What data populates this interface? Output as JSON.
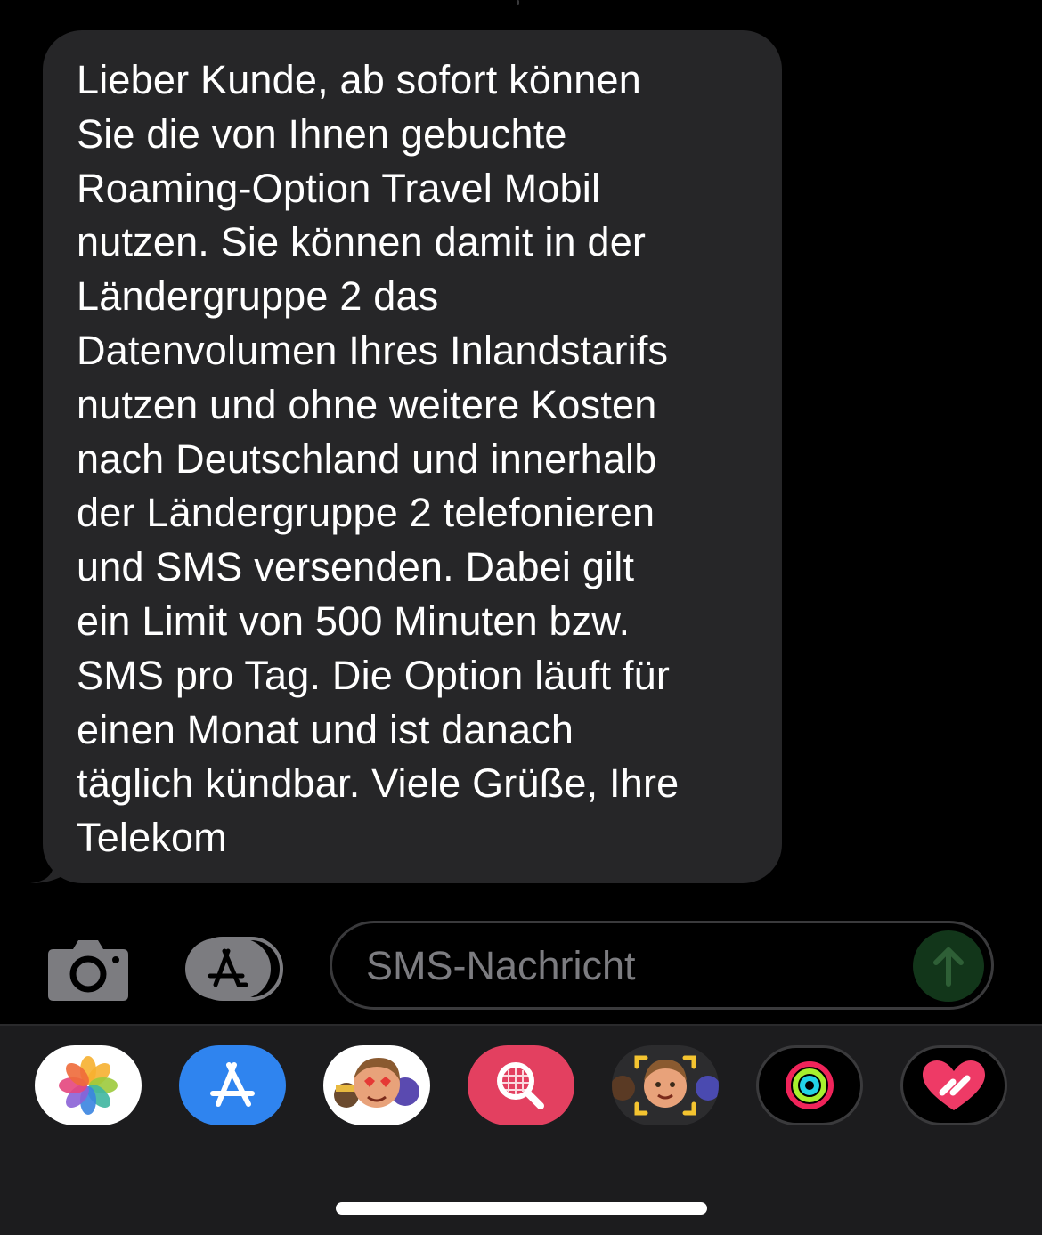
{
  "message": {
    "text": "Lieber Kunde, ab sofort können\nSie die von Ihnen gebuchte\nRoaming-Option Travel Mobil\nnutzen. Sie können damit in der\nLändergruppe 2 das\nDatenvolumen Ihres Inlandstarifs\nnutzen und ohne weitere Kosten\nnach Deutschland und innerhalb\nder Ländergruppe 2 telefonieren\nund SMS versenden. Dabei gilt\nein Limit von 500 Minuten bzw.\nSMS pro Tag. Die Option läuft für\neinen Monat und ist danach\ntäglich kündbar. Viele Grüße, Ihre\nTelekom",
    "bubble_color": "#262628"
  },
  "composer": {
    "placeholder": "SMS-Nachricht",
    "camera_icon": "camera-icon",
    "apps_icon": "app-store-icon",
    "send_icon": "arrow-up-icon",
    "send_color": "#12361a"
  },
  "drawer": {
    "apps": [
      {
        "icon": "photos-icon"
      },
      {
        "icon": "app-store-icon"
      },
      {
        "icon": "memoji-stickers-icon"
      },
      {
        "icon": "images-search-icon"
      },
      {
        "icon": "memoji-camera-icon"
      },
      {
        "icon": "activity-rings-icon"
      },
      {
        "icon": "digital-touch-icon"
      }
    ]
  }
}
